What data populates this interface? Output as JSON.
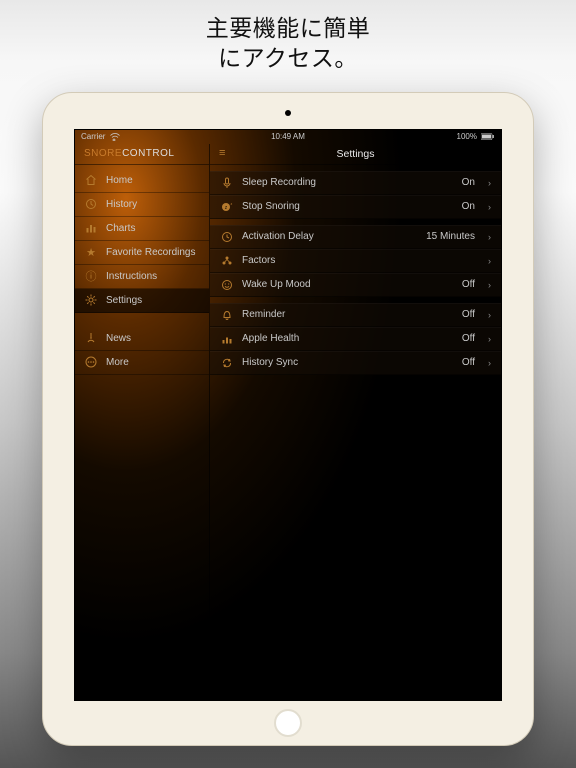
{
  "headline": {
    "line1": "主要機能に簡単",
    "line2": "にアクセス。"
  },
  "statusbar": {
    "carrier": "Carrier",
    "time": "10:49 AM",
    "battery_pct": "100%"
  },
  "app": {
    "title_a": "SNORE",
    "title_b": "CONTROL"
  },
  "sidebar": {
    "items1": [
      {
        "label": "Home",
        "icon": "home"
      },
      {
        "label": "History",
        "icon": "history"
      },
      {
        "label": "Charts",
        "icon": "charts"
      },
      {
        "label": "Favorite Recordings",
        "icon": "star"
      },
      {
        "label": "Instructions",
        "icon": "info"
      },
      {
        "label": "Settings",
        "icon": "gear",
        "selected": true
      }
    ],
    "items2": [
      {
        "label": "News",
        "icon": "news"
      },
      {
        "label": "More",
        "icon": "more"
      }
    ]
  },
  "main": {
    "menu_icon": "menu",
    "title": "Settings",
    "groups": [
      [
        {
          "label": "Sleep Recording",
          "icon": "mic",
          "value": "On"
        },
        {
          "label": "Stop Snoring",
          "icon": "zzz",
          "value": "On"
        }
      ],
      [
        {
          "label": "Activation Delay",
          "icon": "clock",
          "value": "15 Minutes"
        },
        {
          "label": "Factors",
          "icon": "factors",
          "value": ""
        },
        {
          "label": "Wake Up Mood",
          "icon": "mood",
          "value": "Off"
        }
      ],
      [
        {
          "label": "Reminder",
          "icon": "bell",
          "value": "Off"
        },
        {
          "label": "Apple Health",
          "icon": "health",
          "value": "Off"
        },
        {
          "label": "History Sync",
          "icon": "sync",
          "value": "Off"
        }
      ]
    ]
  },
  "icons": {
    "home": "⌂",
    "history": "⟲",
    "charts": "⫿⫿",
    "star": "★",
    "info": "ⓘ",
    "gear": "✻",
    "news": "⍡",
    "more": "⋯",
    "menu": "≡",
    "mic": "🎙",
    "zzz": "z",
    "clock": "◷",
    "factors": "⁂",
    "mood": "☺",
    "bell": "△",
    "health": "⫿",
    "sync": "⟳",
    "chevron": "›",
    "wifi": "◉",
    "battery": "▮"
  }
}
